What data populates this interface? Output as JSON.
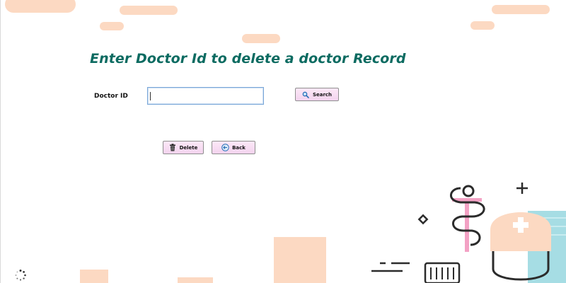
{
  "page": {
    "heading": "Enter Doctor Id to delete a doctor Record"
  },
  "form": {
    "doctor_id_label": "Doctor ID",
    "doctor_id_value": "",
    "search_label": "Search",
    "delete_label": "Delete",
    "back_label": "Back"
  },
  "icons": {
    "search": "search-icon",
    "delete": "trash-icon",
    "back": "back-arrow-icon"
  },
  "colors": {
    "heading": "#0c6b61",
    "button_bg": "#f7dbf1",
    "decor_peach": "#fcd9c2",
    "decor_pink": "#f3a1c4",
    "decor_teal": "#a6dde4"
  }
}
